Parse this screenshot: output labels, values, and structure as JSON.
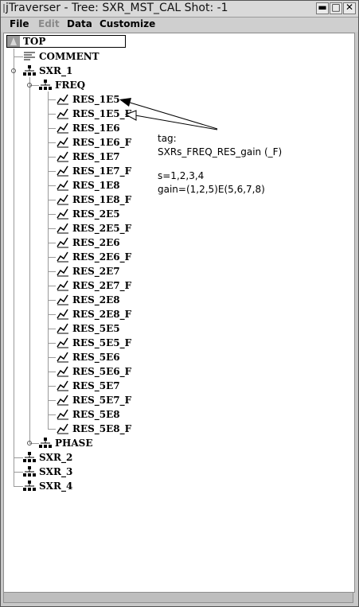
{
  "window": {
    "title": "jTraverser - Tree: SXR_MST_CAL Shot: -1",
    "buttons": {
      "minimize": "▬",
      "maximize": "□",
      "close": "✕"
    }
  },
  "menubar": {
    "file": "File",
    "edit": "Edit",
    "data": "Data",
    "customize": "Customize"
  },
  "tree": {
    "top": "TOP",
    "comment": "COMMENT",
    "sxr_1": "SXR_1",
    "freq": "FREQ",
    "res_items": [
      "RES_1E5",
      "RES_1E5_F",
      "RES_1E6",
      "RES_1E6_F",
      "RES_1E7",
      "RES_1E7_F",
      "RES_1E8",
      "RES_1E8_F",
      "RES_2E5",
      "RES_2E5_F",
      "RES_2E6",
      "RES_2E6_F",
      "RES_2E7",
      "RES_2E7_F",
      "RES_2E8",
      "RES_2E8_F",
      "RES_5E5",
      "RES_5E5_F",
      "RES_5E6",
      "RES_5E6_F",
      "RES_5E7",
      "RES_5E7_F",
      "RES_5E8",
      "RES_5E8_F"
    ],
    "phase": "PHASE",
    "sxr_2": "SXR_2",
    "sxr_3": "SXR_3",
    "sxr_4": "SXR_4"
  },
  "annotation": {
    "line1": "tag:",
    "line2": "SXRs_FREQ_RES_gain (_F)",
    "line3": "s=1,2,3,4",
    "line4": "gain=(1,2,5)E(5,6,7,8)"
  }
}
